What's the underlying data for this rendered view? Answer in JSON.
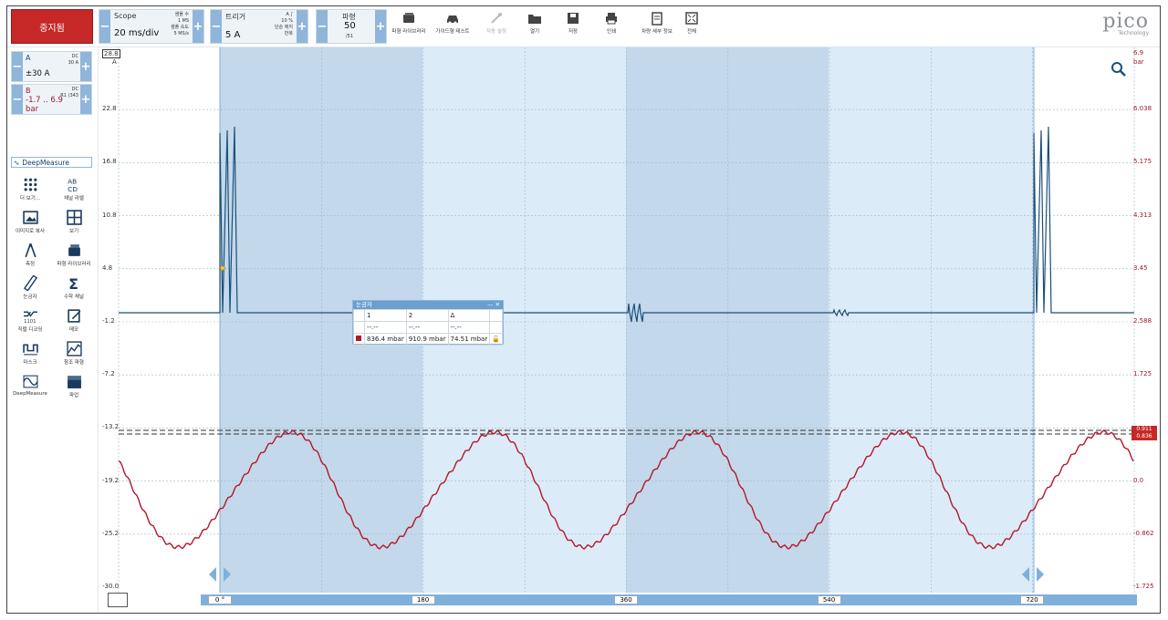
{
  "toolbar": {
    "stop_label": "중지됨",
    "scope": {
      "label": "Scope",
      "timebase": "20 ms/div",
      "samples_label": "샘플 수",
      "samples_value": "1 MS",
      "rate_label": "샘플 속도",
      "rate_value": "5 MS/s"
    },
    "trigger": {
      "label": "트리거",
      "value": "5 A",
      "channel": "A",
      "pct": "10 %",
      "mode_label": "단순 에지",
      "type_label": "반복"
    },
    "waveforms": {
      "label": "파형",
      "value": "50",
      "total": "/51"
    },
    "buttons": [
      {
        "label": "파형 라이브러리",
        "icon": "library-icon",
        "disabled": false
      },
      {
        "label": "가이드형 테스트",
        "icon": "car-icon",
        "disabled": false
      },
      {
        "label": "자동 설정",
        "icon": "wand-icon",
        "disabled": true
      },
      {
        "label": "열기",
        "icon": "folder-icon",
        "disabled": false
      },
      {
        "label": "저장",
        "icon": "save-icon",
        "disabled": false
      },
      {
        "label": "인쇄",
        "icon": "print-icon",
        "disabled": false
      },
      {
        "label": "차량 세부 정보",
        "icon": "clipboard-icon",
        "disabled": false
      },
      {
        "label": "전체",
        "icon": "fullscreen-icon",
        "disabled": false
      }
    ],
    "logo_text": "pico",
    "logo_sub": "Technology"
  },
  "channels": [
    {
      "name": "A",
      "coupling": "DC",
      "range_small": "30 A",
      "range": "±30 A",
      "color": "#1a4f7a"
    },
    {
      "name": "B",
      "coupling": "DC",
      "range_small": "R1 (343",
      "range": "-1.7 .. 6.9",
      "unit": "bar",
      "color": "#9b1b2b"
    }
  ],
  "deepmeasure_label": "DeepMeasure",
  "tools": [
    {
      "label": "더 보기...",
      "icon": "more-icon"
    },
    {
      "label": "채널 라벨",
      "icon": "abcd-icon"
    },
    {
      "label": "이미지로 복사",
      "icon": "image-icon"
    },
    {
      "label": "보기",
      "icon": "grid-icon"
    },
    {
      "label": "측정",
      "icon": "compass-icon"
    },
    {
      "label": "파형 라이브러리",
      "icon": "library-icon"
    },
    {
      "label": "눈금자",
      "icon": "ruler-icon"
    },
    {
      "label": "수학 채널",
      "icon": "sigma-icon"
    },
    {
      "label": "직렬 디코딩",
      "icon": "decode-icon"
    },
    {
      "label": "메모",
      "icon": "memo-icon"
    },
    {
      "label": "마스크",
      "icon": "mask-icon"
    },
    {
      "label": "참조 파형",
      "icon": "reference-icon"
    },
    {
      "label": "DeepMeasure",
      "icon": "deepmeasure-icon"
    },
    {
      "label": "파업",
      "icon": "clapper-icon"
    }
  ],
  "axes": {
    "left_unit": "A",
    "left_ticks": [
      "28.8",
      "22.8",
      "16.8",
      "10.8",
      "4.8",
      "-1.2",
      "-7.2",
      "-13.2",
      "-19.2",
      "-25.2",
      "-30.0"
    ],
    "right_unit": "bar",
    "right_ticks": [
      "6.9",
      "6.038",
      "5.175",
      "4.313",
      "3.45",
      "2.588",
      "1.725",
      "",
      "0.0",
      "-0.862",
      "-1.725"
    ],
    "right_flags": [
      "0.911",
      "0.836"
    ],
    "x_ticks": [
      "0 °",
      "180",
      "360",
      "540",
      "720"
    ]
  },
  "cursor_window": {
    "title": "눈금자",
    "headers": [
      "1",
      "2",
      "Δ"
    ],
    "row_blank": [
      "--.--",
      "--.--",
      "--.--"
    ],
    "row_b": [
      "836.4 mbar",
      "910.9 mbar",
      "74.51 mbar"
    ]
  }
}
